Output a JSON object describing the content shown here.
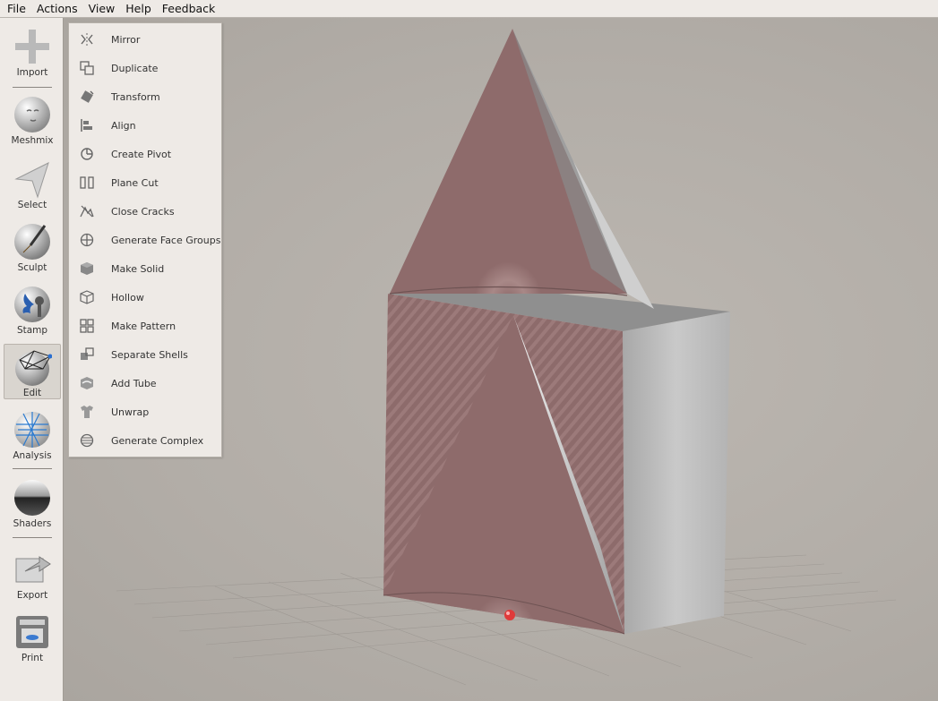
{
  "menubar": {
    "items": [
      "File",
      "Actions",
      "View",
      "Help",
      "Feedback"
    ]
  },
  "toolbar": {
    "items": [
      {
        "label": "Import",
        "icon": "plus-icon"
      },
      {
        "label": "Meshmix",
        "icon": "face-sphere-icon"
      },
      {
        "label": "Select",
        "icon": "arrow-cursor-icon"
      },
      {
        "label": "Sculpt",
        "icon": "brush-sphere-icon"
      },
      {
        "label": "Stamp",
        "icon": "stamp-sphere-icon"
      },
      {
        "label": "Edit",
        "icon": "edit-sphere-icon",
        "active": true
      },
      {
        "label": "Analysis",
        "icon": "mesh-sphere-icon"
      },
      {
        "label": "Shaders",
        "icon": "chrome-sphere-icon"
      },
      {
        "label": "Export",
        "icon": "export-icon"
      },
      {
        "label": "Print",
        "icon": "printer-icon"
      }
    ]
  },
  "edit_menu": {
    "items": [
      {
        "label": "Mirror",
        "icon": "mirror-icon"
      },
      {
        "label": "Duplicate",
        "icon": "duplicate-icon"
      },
      {
        "label": "Transform",
        "icon": "transform-icon"
      },
      {
        "label": "Align",
        "icon": "align-icon"
      },
      {
        "label": "Create Pivot",
        "icon": "pivot-icon"
      },
      {
        "label": "Plane Cut",
        "icon": "plane-cut-icon"
      },
      {
        "label": "Close Cracks",
        "icon": "close-cracks-icon"
      },
      {
        "label": "Generate Face Groups",
        "icon": "face-groups-icon"
      },
      {
        "label": "Make Solid",
        "icon": "make-solid-icon"
      },
      {
        "label": "Hollow",
        "icon": "hollow-icon"
      },
      {
        "label": "Make Pattern",
        "icon": "pattern-icon"
      },
      {
        "label": "Separate Shells",
        "icon": "separate-shells-icon"
      },
      {
        "label": "Add Tube",
        "icon": "add-tube-icon"
      },
      {
        "label": "Unwrap",
        "icon": "unwrap-icon"
      },
      {
        "label": "Generate Complex",
        "icon": "complex-icon"
      }
    ]
  },
  "colors": {
    "panel": "#eeeae6",
    "viewport": "#b4afa9",
    "mesh": "#8a6a6a",
    "selected_dot": "#e03a3a"
  }
}
